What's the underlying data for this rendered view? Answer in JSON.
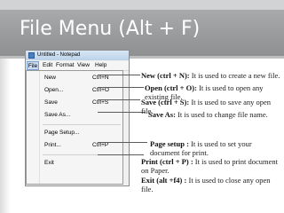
{
  "slide": {
    "title": "File Menu (Alt + F)",
    "colors": {
      "banner": "#9a9b9d",
      "top_band": "#d1d3d4",
      "text": "#222222"
    }
  },
  "window": {
    "title": "Untitled - Notepad",
    "menubar": [
      "File",
      "Edit",
      "Format",
      "View",
      "Help"
    ],
    "menu_items": [
      {
        "label": "New",
        "shortcut": "Ctrl+N"
      },
      {
        "label": "Open...",
        "shortcut": "Ctrl+O"
      },
      {
        "label": "Save",
        "shortcut": "Ctrl+S"
      },
      {
        "label": "Save As...",
        "shortcut": ""
      },
      {
        "label": "Page Setup...",
        "shortcut": ""
      },
      {
        "label": "Print...",
        "shortcut": "Ctrl+P"
      },
      {
        "label": "Exit",
        "shortcut": ""
      }
    ]
  },
  "descriptions": [
    {
      "key": "New (ctrl + N):",
      "text": " It is used to create a new file."
    },
    {
      "key": "Open (ctrl + O):",
      "text": " It is used to open any existing file."
    },
    {
      "key": "Save (ctrl + S):",
      "text": " It is used to save any open file."
    },
    {
      "key": "Save As:",
      "text": " It is used to change file name."
    },
    {
      "key": "Page setup :",
      "text": " It is used to set your document for print."
    },
    {
      "key": "Print (ctrl + P) :",
      "text": " It is used to print document on Paper."
    },
    {
      "key": "Exit (alt +f4) :",
      "text": " It is used to close any open file."
    }
  ]
}
